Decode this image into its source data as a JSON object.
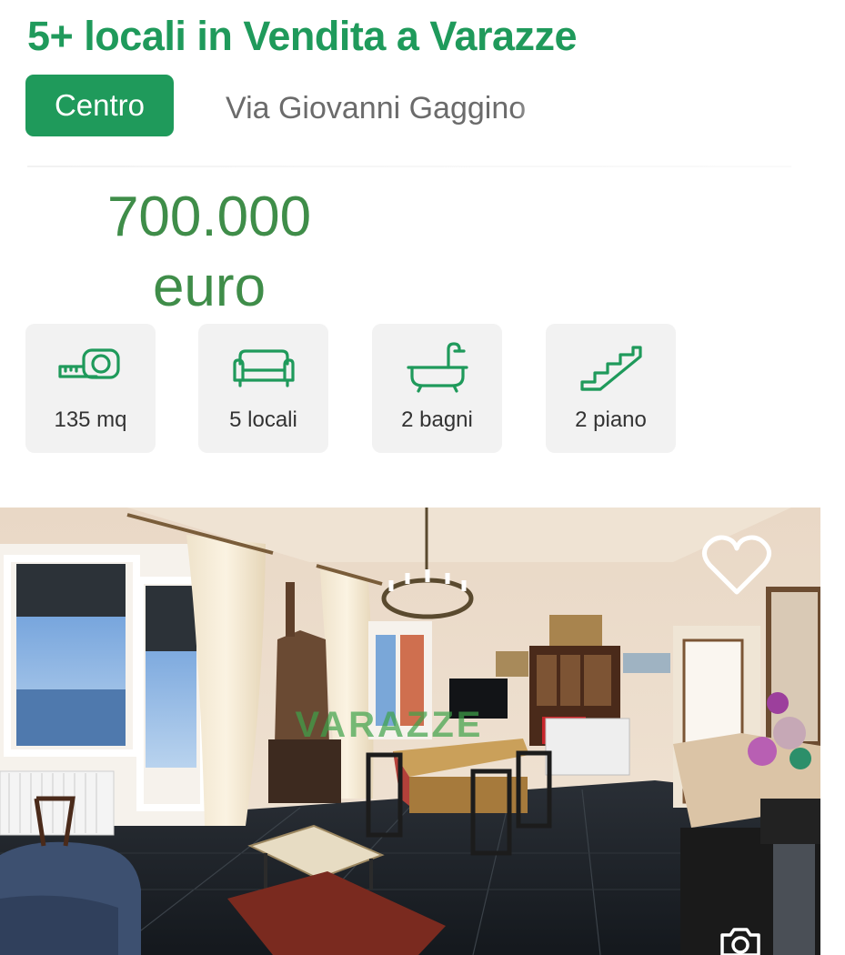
{
  "listing": {
    "title": "5+ locali in Vendita a Varazze",
    "zone": "Centro",
    "address": "Via Giovanni Gaggino",
    "price_amount": "700.000",
    "price_currency": "euro",
    "watermark": "VARAZZE"
  },
  "features": [
    {
      "icon": "measuring-tape-icon",
      "label": "135 mq"
    },
    {
      "icon": "sofa-icon",
      "label": "5 locali"
    },
    {
      "icon": "bathtub-icon",
      "label": "2 bagni"
    },
    {
      "icon": "stairs-icon",
      "label": "2 piano"
    }
  ],
  "colors": {
    "brand_green": "#1f9a5b",
    "price_green": "#3f8d49",
    "card_gray": "#f2f2f2"
  }
}
